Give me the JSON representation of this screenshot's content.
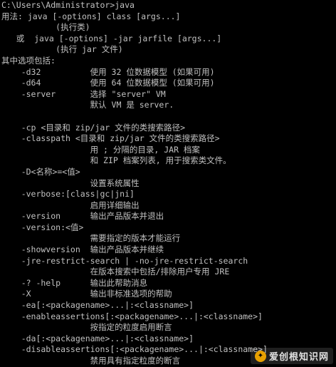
{
  "console": {
    "lines": [
      "C:\\Users\\Administrator>java",
      "用法: java [-options] class [args...]",
      "           (执行类)",
      "   或  java [-options] -jar jarfile [args...]",
      "           (执行 jar 文件)",
      "其中选项包括:",
      "    -d32          使用 32 位数据模型 (如果可用)",
      "    -d64          使用 64 位数据模型 (如果可用)",
      "    -server       选择 \"server\" VM",
      "                  默认 VM 是 server.",
      "",
      "    -cp <目录和 zip/jar 文件的类搜索路径>",
      "    -classpath <目录和 zip/jar 文件的类搜索路径>",
      "                  用 ; 分隔的目录, JAR 档案",
      "                  和 ZIP 档案列表, 用于搜索类文件。",
      "    -D<名称>=<值>",
      "                  设置系统属性",
      "    -verbose:[class|gc|jni]",
      "                  启用详细输出",
      "    -version      输出产品版本并退出",
      "    -version:<值>",
      "                  需要指定的版本才能运行",
      "    -showversion  输出产品版本并继续",
      "    -jre-restrict-search | -no-jre-restrict-search",
      "                  在版本搜索中包括/排除用户专用 JRE",
      "    -? -help      输出此帮助消息",
      "    -X            输出非标准选项的帮助",
      "    -ea[:<packagename>...|:<classname>]",
      "    -enableassertions[:<packagename>...|:<classname>]",
      "                  按指定的粒度启用断言",
      "    -da[:<packagename>...|:<classname>]",
      "    -disableassertions[:<packagename>...|:<classname>]",
      "                  禁用具有指定粒度的断言"
    ]
  },
  "watermark": {
    "logo_glyph": "✦",
    "text": "爱创根知识网"
  },
  "colors": {
    "background": "#000000",
    "text": "#c0c0c0"
  }
}
